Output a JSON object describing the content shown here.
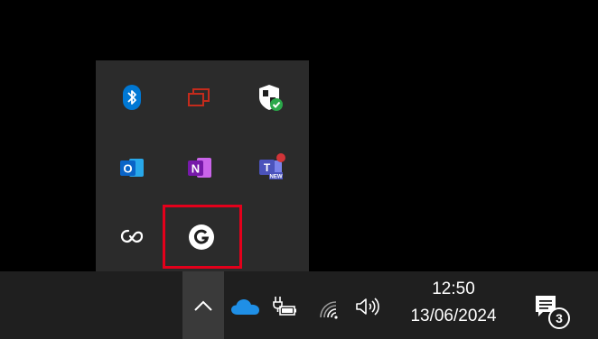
{
  "tray_flyout": {
    "icons": [
      {
        "name": "bluetooth-icon"
      },
      {
        "name": "task-view-icon"
      },
      {
        "name": "windows-security-icon"
      },
      {
        "name": "outlook-icon",
        "letter": "O"
      },
      {
        "name": "onenote-icon",
        "letter": "N"
      },
      {
        "name": "teams-icon",
        "letter": "T",
        "badge": "NEW"
      },
      {
        "name": "creative-cloud-icon"
      },
      {
        "name": "grammarly-icon"
      }
    ]
  },
  "taskbar": {
    "clock": {
      "time": "12:50",
      "date": "13/06/2024"
    },
    "notifications": {
      "count": "3"
    }
  },
  "colors": {
    "highlight": "#e3001b",
    "bluetooth": "#0078d4",
    "outlook": "#0a64c7",
    "onenote": "#7719aa",
    "teams": "#4b53bc",
    "security_check": "#2aa84a",
    "onedrive": "#1f8fe6"
  }
}
